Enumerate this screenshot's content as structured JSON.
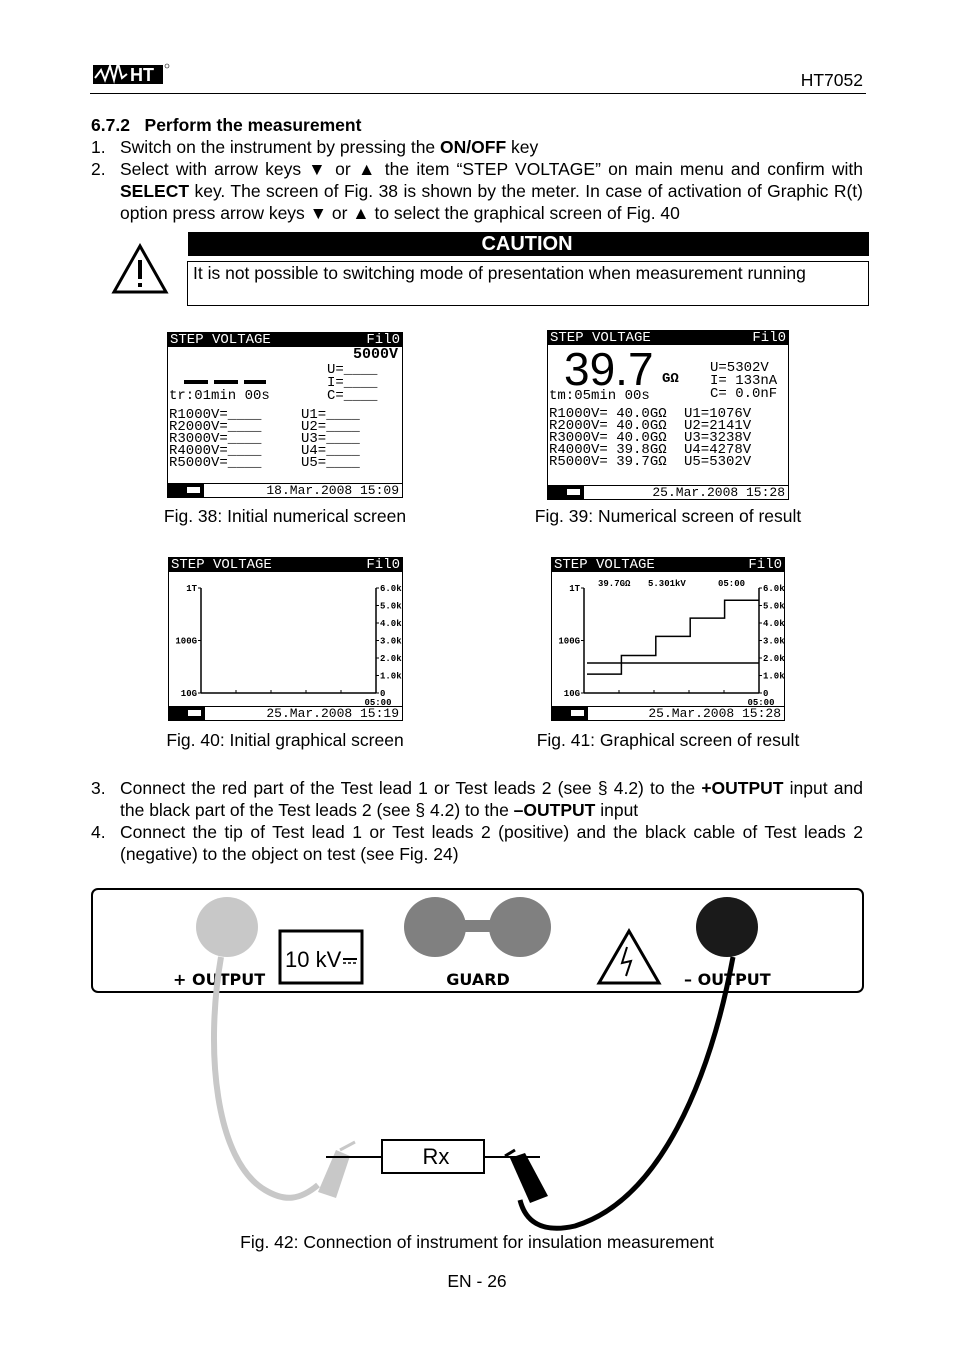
{
  "header": {
    "brand": "HT",
    "model": "HT7052"
  },
  "section": {
    "number": "6.7.2",
    "title": "Perform the measurement"
  },
  "steps": [
    {
      "n": "1.",
      "pre": "Switch on the instrument by pressing the ",
      "bold": "ON/OFF",
      "post": " key"
    },
    {
      "n": "2.",
      "text_a": "Select with arrow keys ▼ or ▲ the item “STEP VOLTAGE” on main menu and confirm with ",
      "bold": "SELECT",
      "text_b": " key. The screen of Fig. 38 is shown by the meter. In case of activation of Graphic R(t) option press arrow keys ▼ or ▲ to select the graphical screen of Fig. 40"
    },
    {
      "n": "3.",
      "a": "Connect the red part of the Test lead 1 or Test leads 2 (see § 4.2) to the ",
      "b1": "+OUTPUT",
      "c": " input and the black part of the Test leads 2 (see § 4.2) to the ",
      "b2": "–OUTPUT",
      "d": " input"
    },
    {
      "n": "4.",
      "text": "Connect the tip of Test lead 1 or Test leads 2 (positive) and the black cable of Test leads 2 (negative) to the object on test (see Fig. 24)"
    }
  ],
  "caution": {
    "title": "CAUTION",
    "text": "It is not possible to switching mode of presentation when measurement running",
    "icon": "warning-triangle-icon"
  },
  "fig38": {
    "title": "STEP VOLTAGE",
    "filter": "Fil0",
    "voltage": "5000V",
    "u": "U=____",
    "i": "I=____",
    "c": "C=____",
    "timer": "tr:01min 00s",
    "rows": [
      "R1000V=____",
      "R2000V=____",
      "R3000V=____",
      "R4000V=____",
      "R5000V=____"
    ],
    "urows": [
      "U1=____",
      "U2=____",
      "U3=____",
      "U4=____",
      "U5=____"
    ],
    "date": "18.Mar.2008 15:09",
    "caption": "Fig. 38: Initial numerical screen"
  },
  "fig39": {
    "title": "STEP VOLTAGE",
    "filter": "Fil0",
    "value": "39.7",
    "unit": "GΩ",
    "u": "U=5302V",
    "i": "I= 133nA",
    "c": "C= 0.0nF",
    "timer": "tm:05min 00s",
    "rows": [
      "R1000V= 40.0GΩ",
      "R2000V= 40.0GΩ",
      "R3000V= 40.0GΩ",
      "R4000V= 39.8GΩ",
      "R5000V= 39.7GΩ"
    ],
    "urows": [
      "U1=1076V",
      "U2=2141V",
      "U3=3238V",
      "U4=4278V",
      "U5=5302V"
    ],
    "date": "25.Mar.2008 15:28",
    "caption": "Fig. 39: Numerical screen of result"
  },
  "fig40": {
    "title": "STEP VOLTAGE",
    "filter": "Fil0",
    "left_ticks": [
      "1T",
      "100G",
      "10G"
    ],
    "right_ticks": [
      "6.0k",
      "5.0k",
      "4.0k",
      "3.0k",
      "2.0k",
      "1.0k",
      "0"
    ],
    "time": "05:00",
    "date": "25.Mar.2008 15:19",
    "caption": "Fig. 40: Initial graphical screen"
  },
  "fig41": {
    "title": "STEP VOLTAGE",
    "filter": "Fil0",
    "left_ticks": [
      "1T",
      "100G",
      "10G"
    ],
    "right_ticks": [
      "6.0k",
      "5.0k",
      "4.0k",
      "3.0k",
      "2.0k",
      "1.0k",
      "0"
    ],
    "readout_r": "39.7GΩ",
    "readout_v": "5.301kV",
    "readout_t": "05:00",
    "time": "05:00",
    "date": "25.Mar.2008 15:28",
    "caption": "Fig. 41: Graphical screen of result",
    "step_voltages_v": [
      1076,
      2141,
      3238,
      4278,
      5302
    ],
    "voltage_axis_max_v": 6000
  },
  "diagram": {
    "plus_output": "+ OUTPUT",
    "guard": "GUARD",
    "minus_output": "– OUTPUT",
    "rating": "10 kV",
    "resistor": "Rx",
    "caption": "Fig. 42: Connection of instrument for insulation measurement",
    "colors": {
      "plus": "#c8c8c8",
      "guard": "#808080",
      "minus": "#1a1a1a"
    }
  },
  "footer": {
    "page": "EN - 26"
  }
}
